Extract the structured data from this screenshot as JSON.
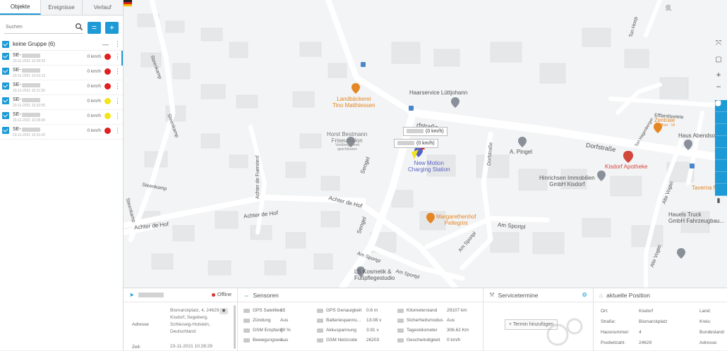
{
  "sidebar": {
    "tabs": [
      "Objekte",
      "Ereignisse",
      "Verlauf"
    ],
    "search_placeholder": "Suchen",
    "filter_button": "=",
    "add_button": "+",
    "group": {
      "label": "keine Gruppe (6)",
      "collapse": "—"
    },
    "vehicles": [
      {
        "name": "SE-",
        "time": "23-11-2021 10:28:29",
        "speed": "0 km/h",
        "status_color": "#e02020"
      },
      {
        "name": "SE-",
        "time": "23-11-2021 10:52:13",
        "speed": "0 km/h",
        "status_color": "#e02020"
      },
      {
        "name": "SE-",
        "time": "23-11-2021 10:11:33",
        "speed": "0 km/h",
        "status_color": "#e02020"
      },
      {
        "name": "SE-",
        "time": "23-11-2021 10:32:05",
        "speed": "0 km/h",
        "status_color": "#f2e31a"
      },
      {
        "name": "SE-",
        "time": "23-11-2021 10:28:30",
        "speed": "0 km/h",
        "status_color": "#f2e31a"
      },
      {
        "name": "SE-",
        "time": "23-11-2021 10:31:02",
        "speed": "0 km/h",
        "status_color": "#e02020"
      }
    ]
  },
  "map": {
    "streets": {
      "dorfstrasse_1": "Dorfstraße",
      "dorfstrasse_2": "Dorfstraße",
      "dorfstrasse_partial": "rfstraße",
      "achter_de_hof_1": "Achter de Hof",
      "achter_de_hof_2": "Achter de Hof",
      "achter_de_hof_3": "Achter de Hof",
      "achter_de_fuerstenf": "Achter de Fuerstenf",
      "steenkamp_1": "Steenkamp",
      "steenkamp_2": "Steenkamp",
      "steenkamp_3": "Steenkamp",
      "steenkamp_4": "Steenkamp",
      "sengel_1": "Sengel",
      "sengel_2": "Sengel",
      "am_sportpl_1": "Am Sportpl",
      "am_sportpl_2": "Am Sportpl",
      "am_sportpl_3": "Am Sportpl",
      "am_sportpl_4": "Am Sportpl",
      "effland": "Efflandswiete",
      "efflandswiete2": "Efflands",
      "ton_hoop": "Ton Hoop",
      "ton_hagen": "Ton Hagenberger",
      "alte_vogtei_1": "Alte Vogtei",
      "alte_vogtei_2": "Alte Vogtei",
      "dorfweg": "Dorfstraße"
    },
    "pois": {
      "landbaeckerei": "Landbäckerei\nTino Matthiessen",
      "haarservice": "Haarservice Lüttjohann",
      "horst": "Horst Bestmann\nFriseursalon",
      "horst_sub": "Vorübergehend\ngeschlossen",
      "new_motion": "New Motion\nCharging Station",
      "a_pingel": "A. Pingel",
      "hinrichsen": "Hinrichsen Immobilien\nGmbH Kisdorf",
      "kisdorf_apotheke": "Kisdorf Apotheke",
      "zentrale": "Zentrale",
      "zentrale_sub": "Geöffnet · 18",
      "haus_abendsonne": "Haus Abendso",
      "taverna": "Taverna M",
      "margarethenhof": "Margarethenhof\nPellegrini",
      "hauels": "Hauels Truck\nGmbH Fahrzeugbau...",
      "ls_kosmetik": "LS Kosmetik &\nFußpflegestudio"
    },
    "vehicle_tooltip_1": "(0 km/h)",
    "vehicle_tooltip_2": "(0 km/h)"
  },
  "status_panel": {
    "offline_label": "Offline",
    "address_label": "Adresse",
    "address_value": "Bismarckplatz, 4, 24629, Kisdorf, Segeberg, Schleswig-Holstein, Deutschland",
    "time_label": "Zeit:",
    "time_value": "23-11-2021 10:28:29"
  },
  "sensors": {
    "title": "Sensoren",
    "rows": [
      {
        "label": "GPS Satelliten",
        "value": "15",
        "label2": "GPS Genauigkeit",
        "value2": "0.6 m",
        "label3": "Kilometerstand",
        "value3": "29107 km"
      },
      {
        "label": "Zündung",
        "value": "Aus",
        "label2": "Batteriespannu...",
        "value2": "13.08 v",
        "label3": "Sicherheitsmodus",
        "value3": "Aus"
      },
      {
        "label": "GSM Empfang",
        "value": "80 %",
        "label2": "Akkuspannung",
        "value2": "3.91 v",
        "label3": "Tageskilometer",
        "value3": "306.62 Km"
      },
      {
        "label": "Bewegungsen...",
        "value": "Aus",
        "label2": "GSM Netzcode",
        "value2": "26203",
        "label3": "Geschwindigkeit",
        "value3": "0 km/h"
      }
    ]
  },
  "service": {
    "title": "Servicetermine",
    "add_label": "Termin hinzufügen"
  },
  "position": {
    "title": "aktuelle Position",
    "rows": [
      {
        "label": "Ort:",
        "value": "Kisdorf",
        "label2": "Land:"
      },
      {
        "label": "Straße:",
        "value": "Bismarckplatz",
        "label2": "Kreis:"
      },
      {
        "label": "Hausnummer:",
        "value": "4",
        "label2": "Bundesland:"
      },
      {
        "label": "Postleitzahl:",
        "value": "24629",
        "label2": "Adresse:"
      }
    ]
  },
  "colors": {
    "accent": "#1e9ad6",
    "offline": "#e03030",
    "poi_orange": "#e48624",
    "poi_red": "#d2473c",
    "poi_blue": "#5562c4"
  }
}
